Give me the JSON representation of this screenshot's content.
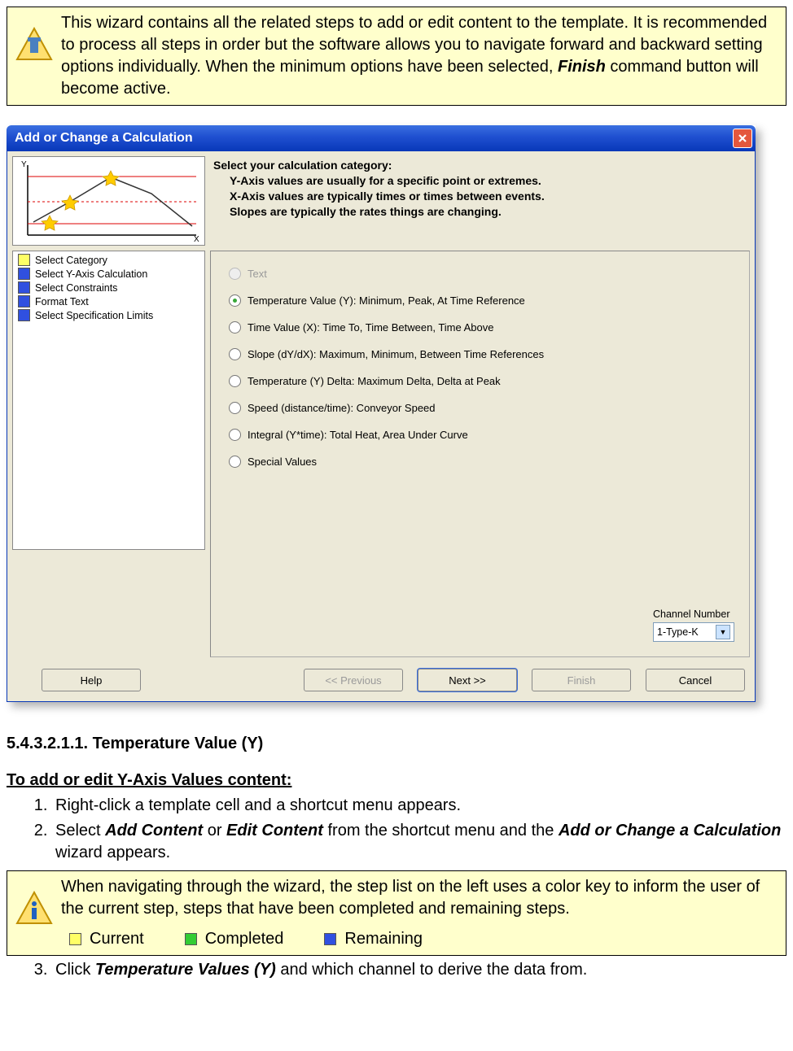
{
  "note1": {
    "text_pre": "This wizard contains all the related steps to add or edit content to the template. It is recommended to process all steps in order but the software allows you to navigate forward and backward setting options individually. When the minimum options have been selected, ",
    "bold": "Finish",
    "text_post": " command button will become active."
  },
  "dialog": {
    "title": "Add or Change a Calculation",
    "instruction": {
      "heading": "Select your calculation category:",
      "line1": "Y-Axis values are usually for a specific point or extremes.",
      "line2": "X-Axis values are typically times or times between events.",
      "line3": "Slopes are typically the rates things are changing."
    },
    "steps": [
      {
        "color": "yellow",
        "label": "Select Category"
      },
      {
        "color": "blue",
        "label": "Select Y-Axis Calculation"
      },
      {
        "color": "blue",
        "label": "Select Constraints"
      },
      {
        "color": "blue",
        "label": "Format Text"
      },
      {
        "color": "blue",
        "label": "Select Specification Limits"
      }
    ],
    "radios": [
      {
        "label": "Text",
        "selected": false,
        "disabled": true
      },
      {
        "label": "Temperature Value (Y):  Minimum, Peak, At Time Reference",
        "selected": true,
        "disabled": false
      },
      {
        "label": "Time Value (X):  Time To, Time Between, Time Above",
        "selected": false,
        "disabled": false
      },
      {
        "label": "Slope (dY/dX):  Maximum, Minimum, Between Time References",
        "selected": false,
        "disabled": false
      },
      {
        "label": "Temperature (Y) Delta:  Maximum Delta, Delta at Peak",
        "selected": false,
        "disabled": false
      },
      {
        "label": "Speed (distance/time): Conveyor Speed",
        "selected": false,
        "disabled": false
      },
      {
        "label": "Integral (Y*time): Total Heat, Area Under Curve",
        "selected": false,
        "disabled": false
      },
      {
        "label": "Special  Values",
        "selected": false,
        "disabled": false
      }
    ],
    "channel": {
      "label": "Channel Number",
      "value": "1-Type-K"
    },
    "buttons": {
      "help": "Help",
      "prev": "<< Previous",
      "next": "Next >>",
      "finish": "Finish",
      "cancel": "Cancel"
    }
  },
  "section": {
    "number_title": "5.4.3.2.1.1. Temperature Value (Y)",
    "sub": "To add or edit Y-Axis Values content:",
    "step1": "Right-click a template cell and a shortcut menu appears.",
    "step2_pre": "Select ",
    "step2_b1": "Add Content",
    "step2_mid": " or ",
    "step2_b2": "Edit Content",
    "step2_mid2": " from the shortcut menu and the ",
    "step2_b3": "Add or Change a Calculation",
    "step2_post": " wizard appears.",
    "step3_pre": "Click ",
    "step3_b": "Temperature Values (Y)",
    "step3_post": " and which channel to derive the data from."
  },
  "note2": {
    "text": "When navigating through the wizard, the step list on the left uses a color key to inform the user of the current step, steps that have been completed and remaining steps.",
    "legend": {
      "current": "Current",
      "completed": "Completed",
      "remaining": "Remaining"
    }
  }
}
